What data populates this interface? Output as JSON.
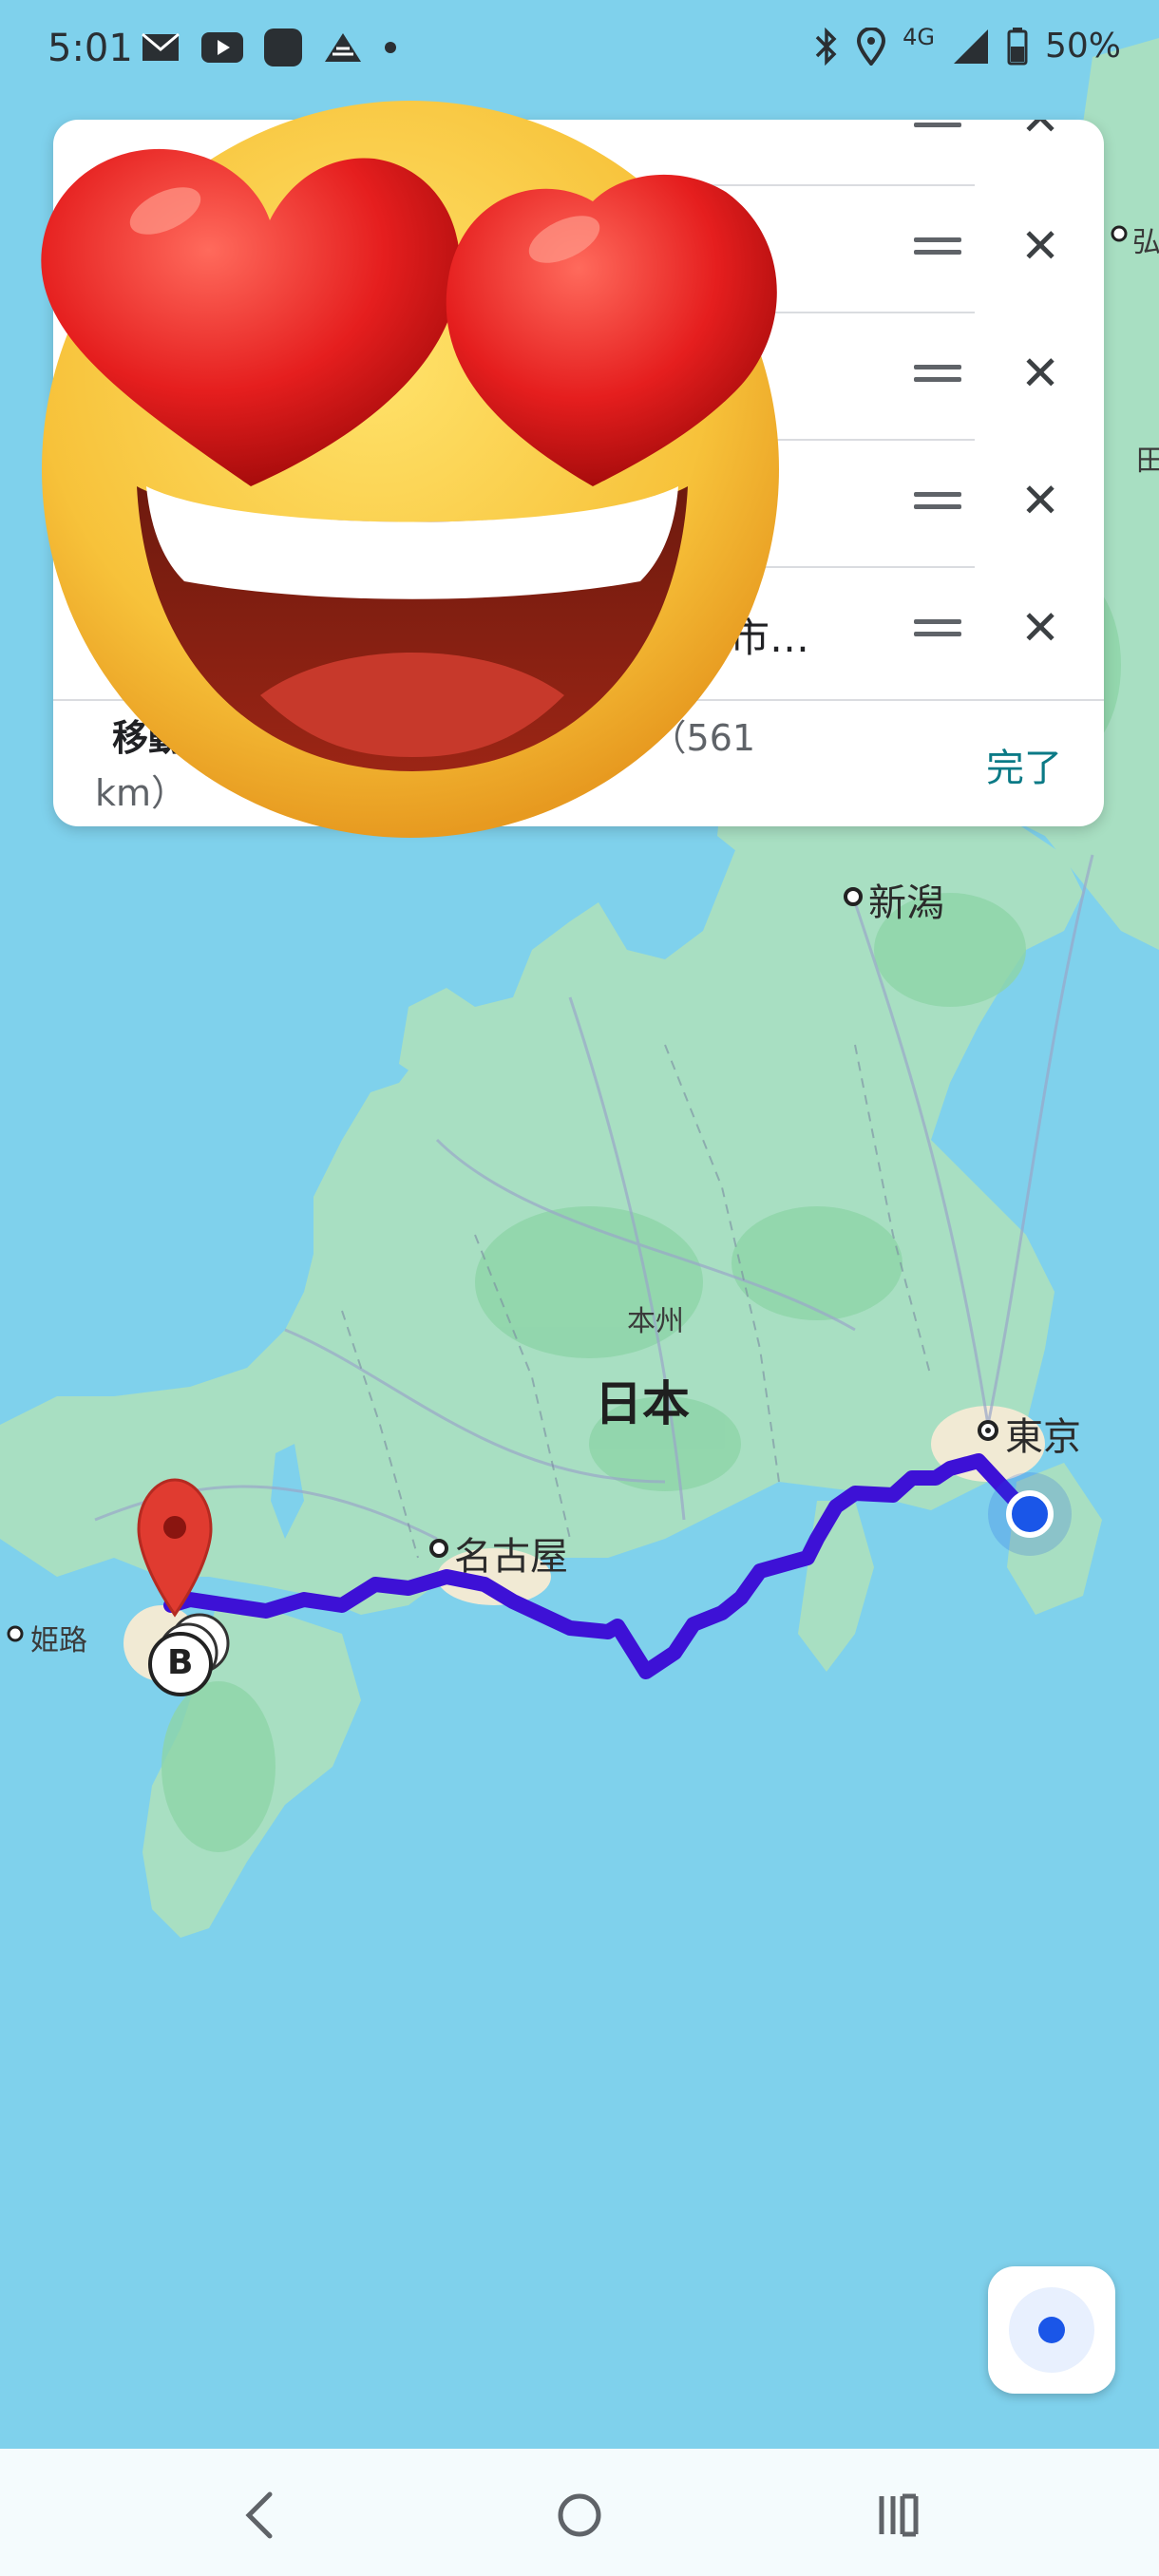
{
  "status_bar": {
    "time": "5:01",
    "network": "4G",
    "battery": "50%",
    "left_icons": [
      "mail-icon",
      "youtube-icon",
      "app-icon",
      "app-triangle-icon",
      "dot-icon"
    ],
    "right_icons": [
      "bluetooth-icon",
      "location-icon",
      "signal-icon",
      "battery-icon"
    ]
  },
  "directions_card": {
    "stops": [
      {
        "text": ""
      },
      {
        "text": ""
      },
      {
        "text": ""
      },
      {
        "text": "．"
      },
      {
        "text": "市…"
      }
    ],
    "summary_label": "移動",
    "summary_value": "9 分 （561",
    "summary_unit": "km）",
    "done_label": "完了"
  },
  "map": {
    "labels": {
      "niigata": "新潟",
      "honshu": "本州",
      "japan": "日本",
      "tokyo": "東京",
      "nagoya": "名古屋",
      "himeji": "姫路",
      "edge_top": "弘",
      "edge_mid": "田"
    },
    "marker_b": "B",
    "route_color": "#3d11d6",
    "current_location_color": "#1a56e8",
    "destination_pin_color": "#e03b30"
  },
  "sticker": {
    "name": "heart-eyes-emoji"
  },
  "nav_bar": {
    "icons": [
      "back-icon",
      "home-icon",
      "recents-icon"
    ]
  }
}
